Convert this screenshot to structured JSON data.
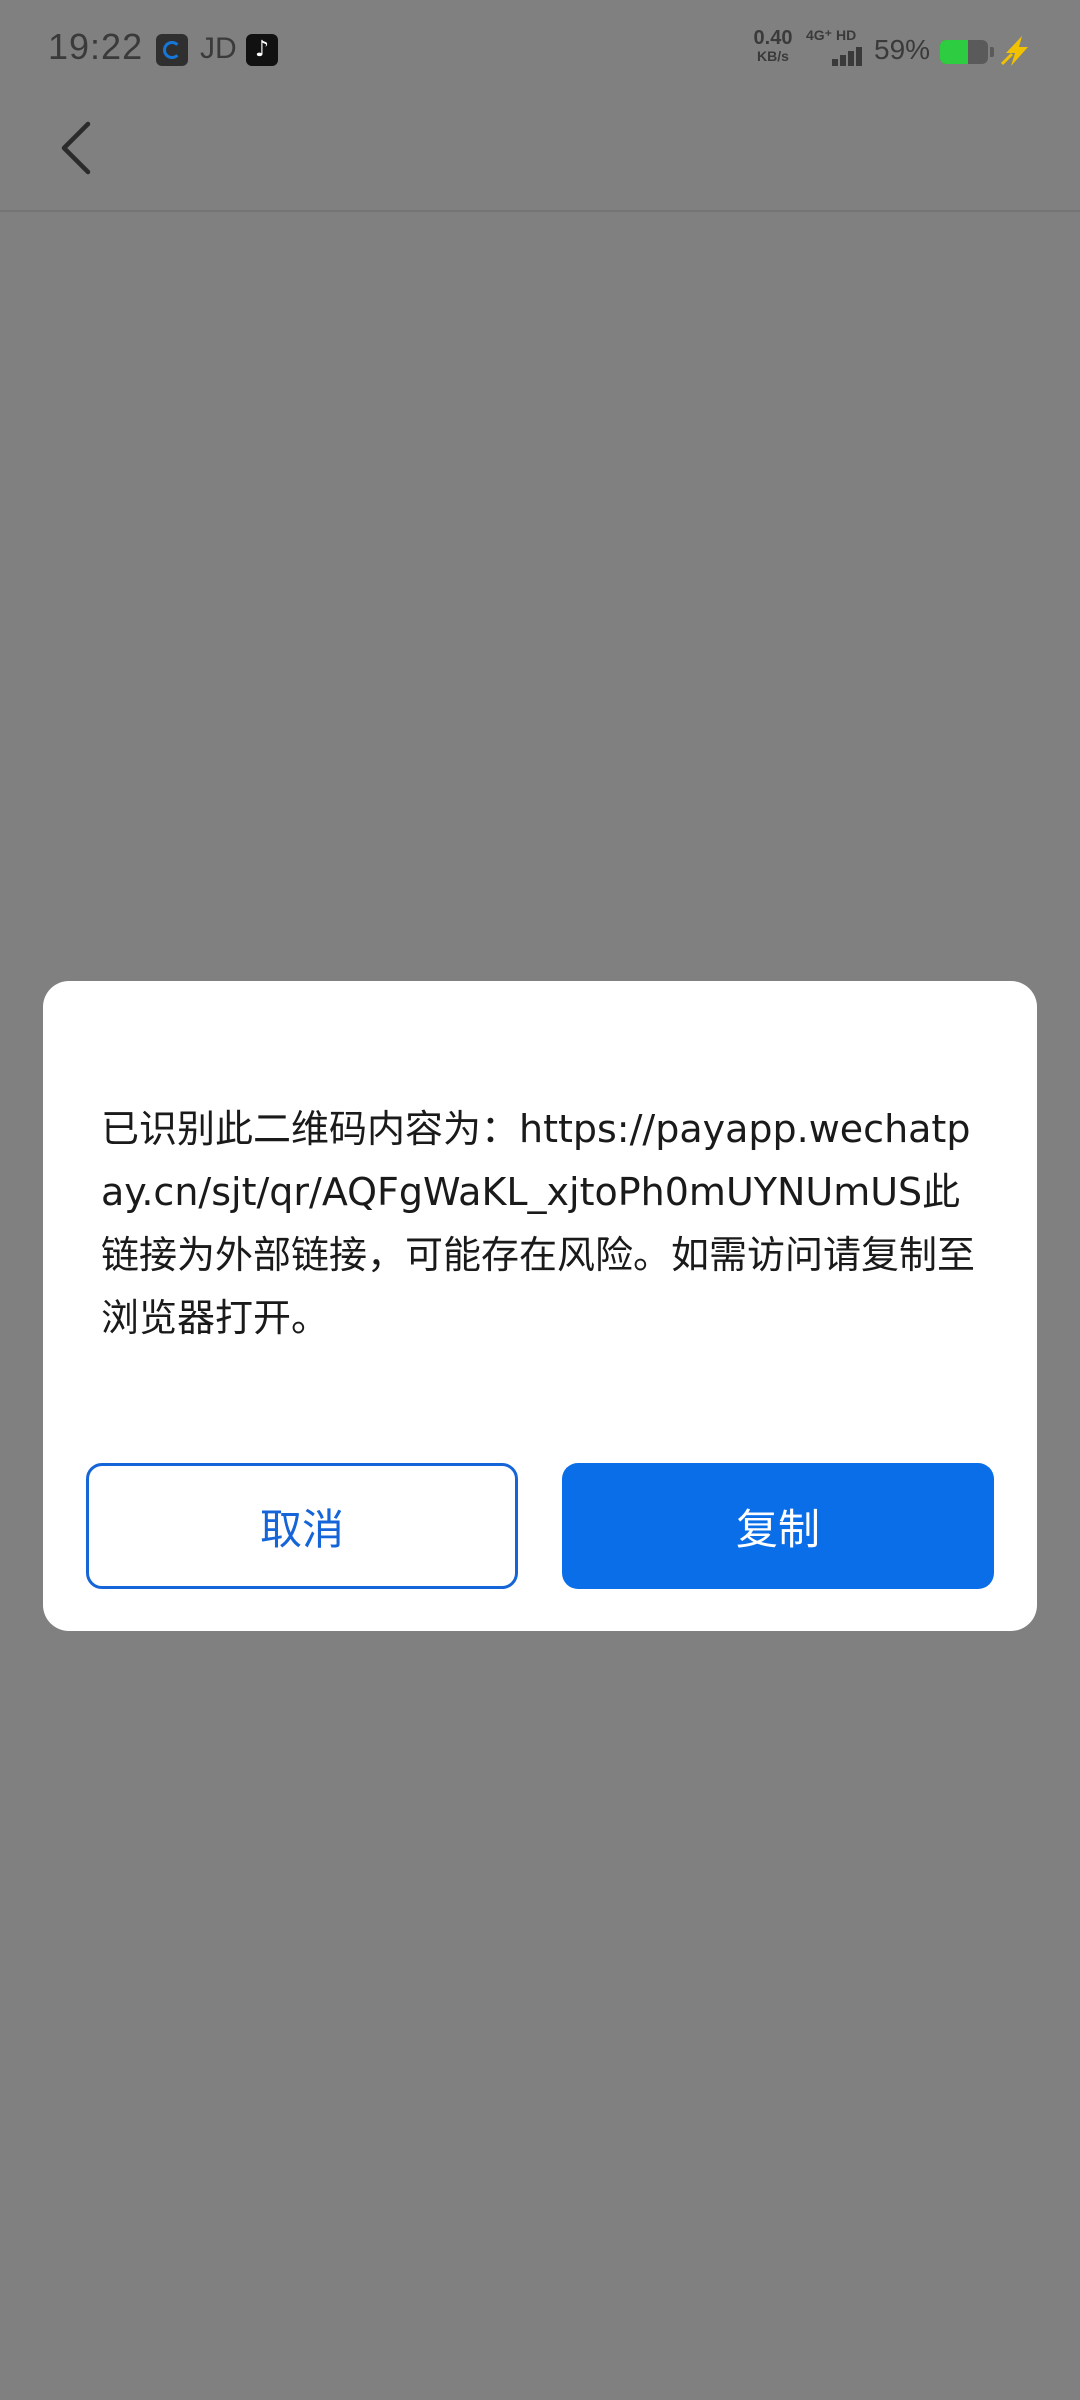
{
  "status_bar": {
    "time": "19:22",
    "jd_label": "JD",
    "net_speed_value": "0.40",
    "net_speed_unit": "KB/s",
    "net_type": "4G⁺ HD",
    "battery_percent": "59%",
    "battery_level": 0.59,
    "icons": [
      "app-c-icon",
      "tiktok-icon",
      "signal-icon",
      "battery-icon",
      "charging-icon"
    ]
  },
  "nav": {
    "back_icon": "chevron-left-icon"
  },
  "dialog": {
    "message": "已识别此二维码内容为：https://payapp.wechatpay.cn/sjt/qr/AQFgWaKL_xjtoPh0mUYNUmUS此链接为外部链接，可能存在风险。如需访问请复制至浏览器打开。",
    "cancel_label": "取消",
    "copy_label": "复制"
  },
  "colors": {
    "overlay": "#808080",
    "primary": "#0a6ee8",
    "cancel_text": "#1565d8",
    "battery_fill": "#2ecc40",
    "charge_bolt": "#f2c200"
  }
}
